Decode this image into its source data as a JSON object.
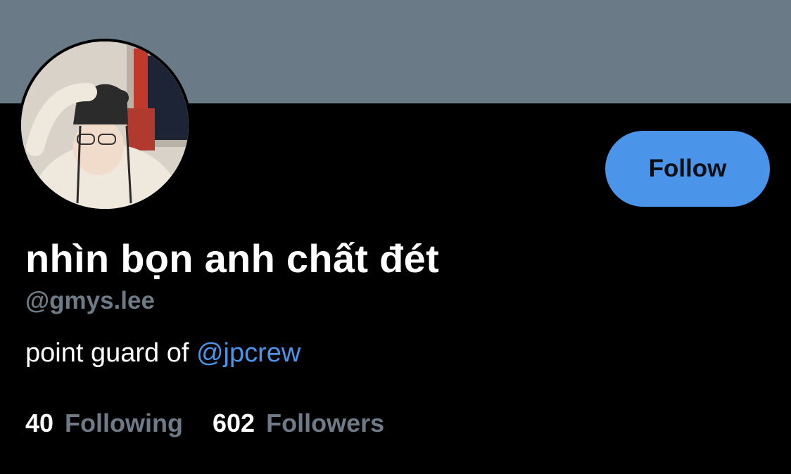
{
  "banner": {
    "color": "#6a7a87"
  },
  "profile": {
    "display_name": "nhìn bọn anh chất đét",
    "handle": "@gmys.lee",
    "bio_text": "point guard of ",
    "bio_mention": "@jpcrew",
    "avatar_alt": "profile photo"
  },
  "actions": {
    "follow_label": "Follow",
    "accent_color": "#4a94ea"
  },
  "stats": {
    "following_count": "40",
    "following_label": "Following",
    "followers_count": "602",
    "followers_label": "Followers"
  }
}
